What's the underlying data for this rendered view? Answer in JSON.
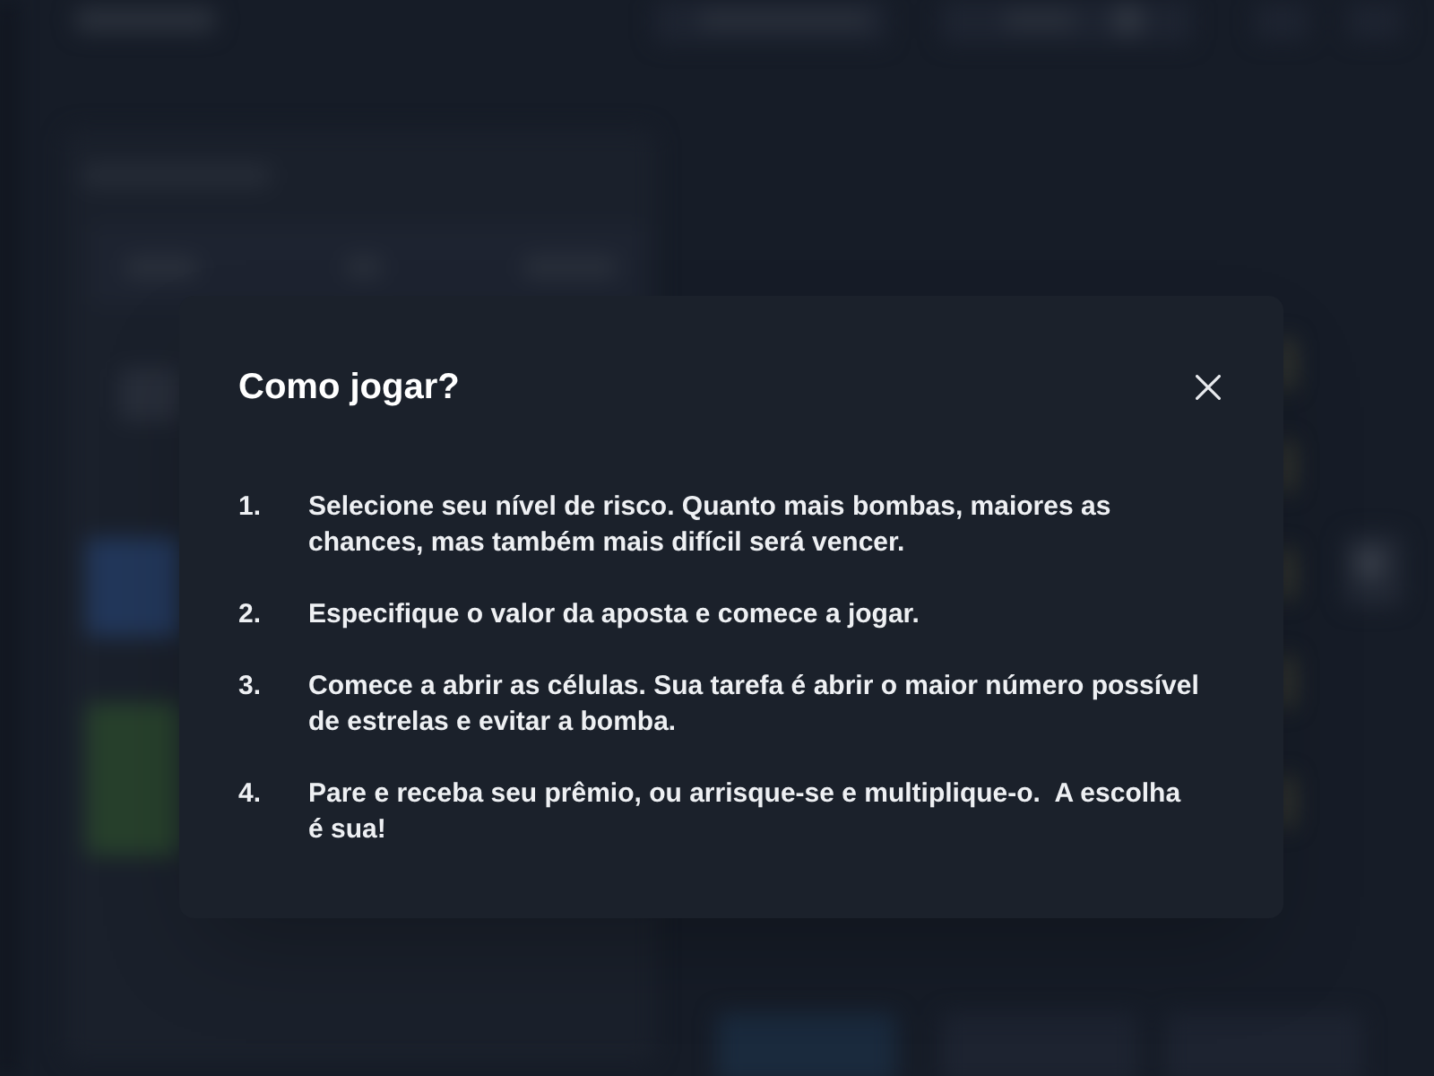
{
  "dialog": {
    "title": "Como jogar?",
    "steps": [
      {
        "number": "1.",
        "text": "Selecione seu nível de risco. Quanto mais bombas, maiores as chances, mas também mais difícil será vencer."
      },
      {
        "number": "2.",
        "text": "Especifique o valor da aposta e comece a jogar."
      },
      {
        "number": "3.",
        "text": "Comece a abrir as células. Sua tarefa é abrir o maior número possível de estrelas e evitar a bomba."
      },
      {
        "number": "4.",
        "text": "Pare e receba seu prêmio, ou arrisque-se e multiplique-o.  A escolha é sua!"
      }
    ]
  }
}
